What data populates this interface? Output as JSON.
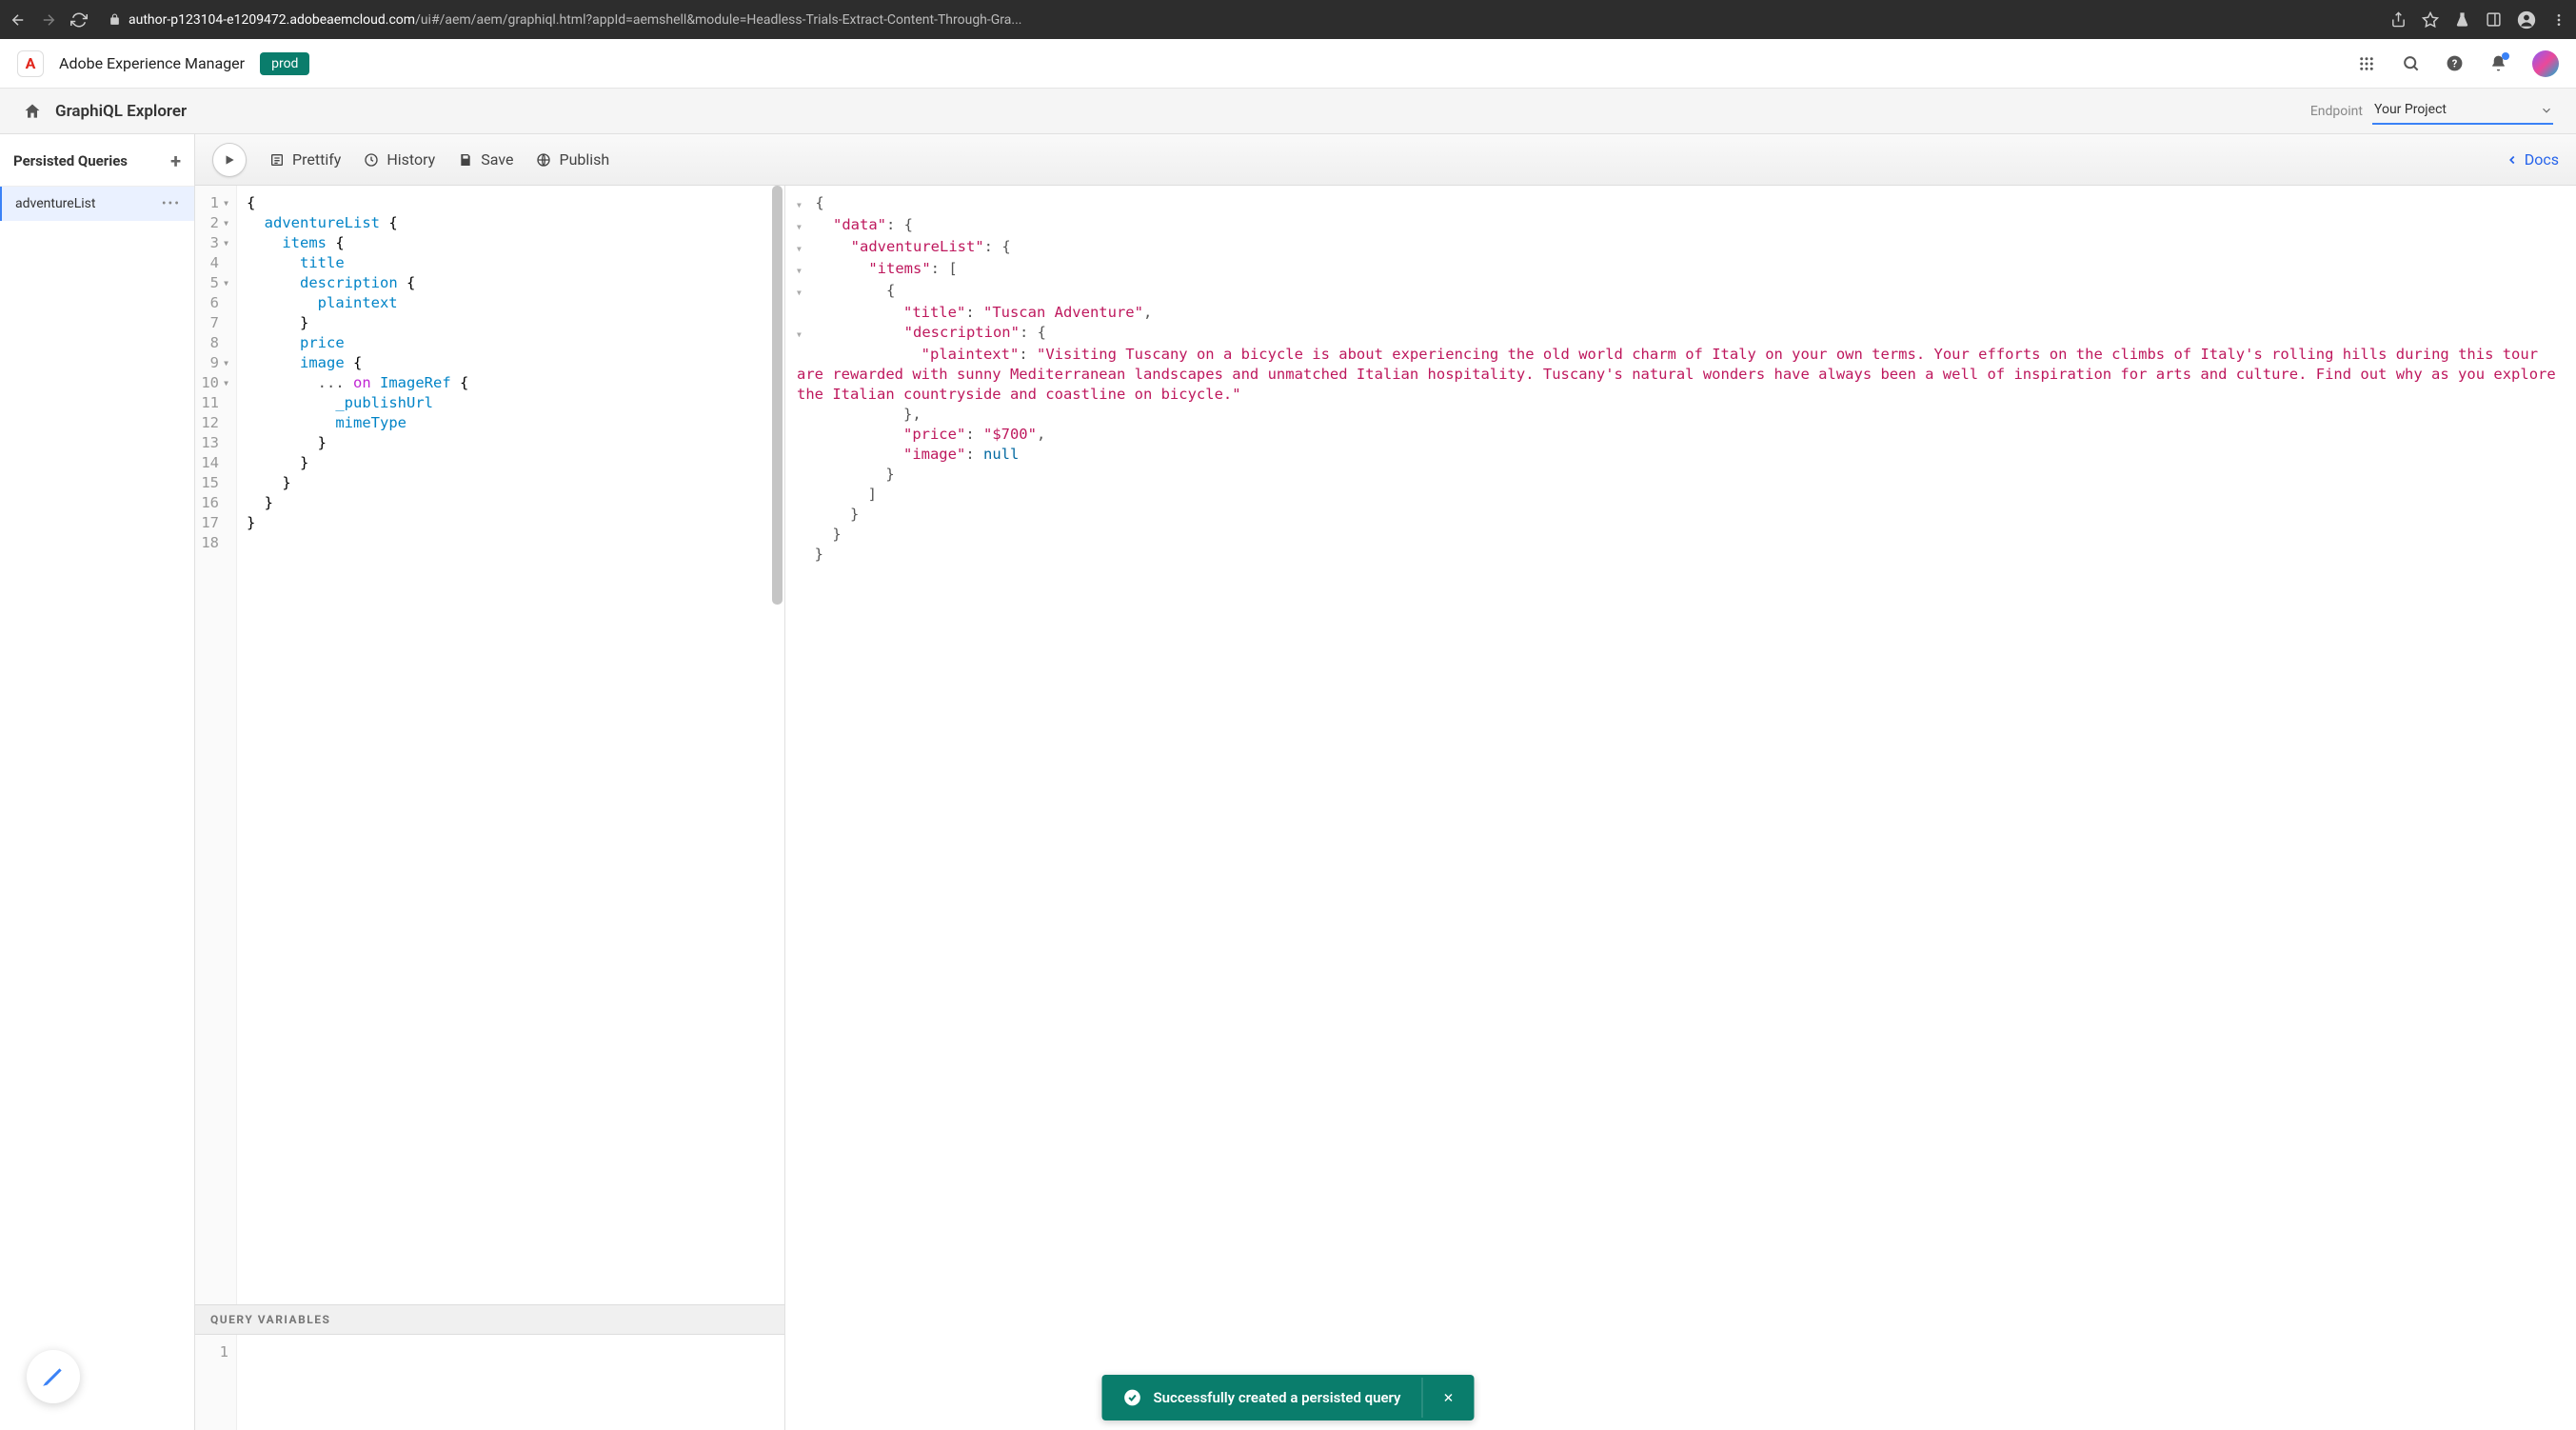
{
  "browser": {
    "url_prefix": "author-p123104-e1209472.adobeaemcloud.com",
    "url_rest": "/ui#/aem/aem/graphiql.html?appId=aemshell&module=Headless-Trials-Extract-Content-Through-Gra..."
  },
  "aem": {
    "product": "Adobe Experience Manager",
    "env_badge": "prod"
  },
  "breadcrumb": {
    "title": "GraphiQL Explorer",
    "endpoint_label": "Endpoint",
    "endpoint_value": "Your Project"
  },
  "sidebar": {
    "header": "Persisted Queries",
    "items": [
      {
        "name": "adventureList"
      }
    ]
  },
  "toolbar": {
    "prettify": "Prettify",
    "history": "History",
    "save": "Save",
    "publish": "Publish",
    "docs": "Docs"
  },
  "query_lines": [
    "{",
    "  adventureList {",
    "    items {",
    "      title",
    "      description {",
    "        plaintext",
    "      }",
    "      price",
    "      image {",
    "        ... on ImageRef {",
    "          _publishUrl",
    "          mimeType",
    "        }",
    "      }",
    "    }",
    "  }",
    "}",
    ""
  ],
  "vars_header": "QUERY VARIABLES",
  "result": {
    "data": {
      "adventureList": {
        "items": [
          {
            "title": "Tuscan Adventure",
            "description": {
              "plaintext": "Visiting Tuscany on a bicycle is about experiencing the old world charm of Italy on your own terms. Your efforts on the climbs of Italy's rolling hills during this tour are rewarded with sunny Mediterranean landscapes and unmatched Italian hospitality. Tuscany's natural wonders have always been a well of inspiration for arts and culture. Find out why as you explore the Italian countryside and coastline on bicycle."
            },
            "price": "$700",
            "image": null
          }
        ]
      }
    }
  },
  "toast": {
    "message": "Successfully created a persisted query"
  }
}
